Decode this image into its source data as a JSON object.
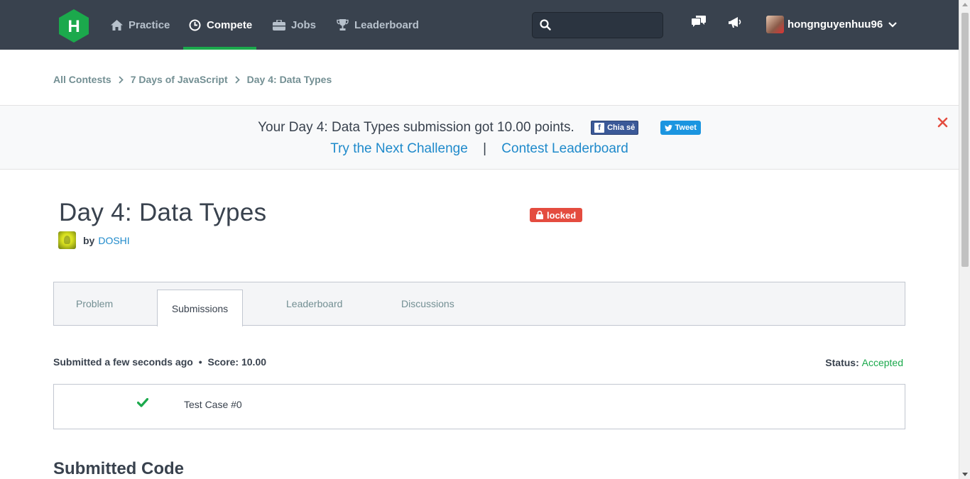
{
  "nav": {
    "logo_letter": "H",
    "items": [
      {
        "label": "Practice",
        "icon": "home-icon"
      },
      {
        "label": "Compete",
        "icon": "clock-icon",
        "active": true
      },
      {
        "label": "Jobs",
        "icon": "briefcase-icon"
      },
      {
        "label": "Leaderboard",
        "icon": "trophy-icon"
      }
    ],
    "search": {
      "placeholder": "",
      "value": ""
    },
    "username": "hongnguyenhuu96"
  },
  "breadcrumb": {
    "items": [
      "All Contests",
      "7 Days of JavaScript",
      "Day 4: Data Types"
    ]
  },
  "notice": {
    "message": "Your Day 4: Data Types submission got 10.00 points.",
    "fb_label": "Chia sẻ",
    "tw_label": "Tweet",
    "next_link": "Try the Next Challenge",
    "separator": "|",
    "leaderboard_link": "Contest Leaderboard"
  },
  "challenge": {
    "title": "Day 4: Data Types",
    "badge": "locked",
    "by_label": "by",
    "author": "DOSHI"
  },
  "tabs": [
    "Problem",
    "Submissions",
    "Leaderboard",
    "Discussions"
  ],
  "submission": {
    "meta_time": "Submitted a few seconds ago",
    "meta_dot": "•",
    "meta_score": "Score: 10.00",
    "status_label": "Status:",
    "status_value": "Accepted",
    "test_cases": [
      {
        "label": "Test Case #0",
        "passed": true
      }
    ]
  },
  "section_title": "Submitted Code",
  "colors": {
    "nav_bg": "#39424e",
    "accent_green": "#1ba94c",
    "link_blue": "#1f8acb",
    "badge_red": "#e44c3f"
  }
}
